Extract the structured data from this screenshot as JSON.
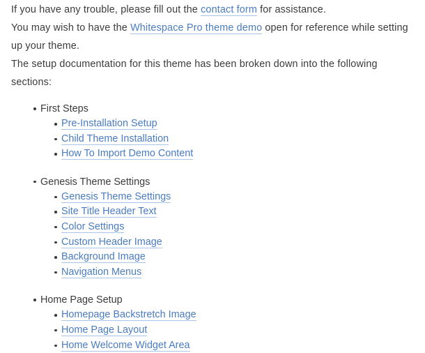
{
  "document": {
    "paragraphs": [
      {
        "id": "trouble",
        "before": "If you have any trouble, please fill out the ",
        "link": "contact form",
        "after": " for assistance."
      },
      {
        "id": "demo-reference",
        "before": "You may wish to have the ",
        "link": "Whitespace Pro theme demo",
        "after": " open for reference while setting up your theme."
      },
      {
        "id": "sections-intro",
        "before": "The setup documentation for this theme has been broken down into the following sections:",
        "link": "",
        "after": ""
      }
    ],
    "sections": [
      {
        "heading": "First Steps",
        "links": [
          "Pre-Installation Setup",
          "Child Theme Installation",
          "How To Import Demo Content"
        ]
      },
      {
        "heading": "Genesis Theme Settings",
        "links": [
          "Genesis Theme Settings",
          "Site Title Header Text",
          "Color Settings",
          "Custom Header Image",
          "Background Image",
          "Navigation Menus"
        ]
      },
      {
        "heading": "Home Page Setup",
        "links": [
          "Homepage Backstretch Image",
          "Home Page Layout",
          "Home Welcome Widget Area"
        ]
      }
    ],
    "colors": {
      "text": "#3b3b3b",
      "link": "#4a7cc0",
      "link_underline": "#a8c4e6",
      "background": "#ffffff"
    }
  }
}
